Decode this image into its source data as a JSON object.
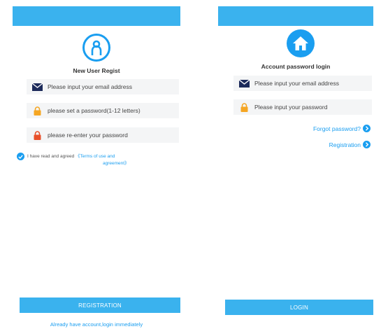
{
  "register": {
    "title": "New User Regist",
    "email_placeholder": "Please input your email address",
    "password_placeholder": "please set a password(1-12 letters)",
    "reenter_placeholder": "please re-enter your password",
    "agree_text": "I have read and agreed",
    "terms_link_line1": "《Terms of use and",
    "terms_link_line2": "agreement》",
    "button_label": "REGISTRATION",
    "login_link": "Already have account,login immediately"
  },
  "login": {
    "title": "Account password login",
    "email_placeholder": "Please input your email address",
    "password_placeholder": "Please input your password",
    "forgot_link": "Forgot password?",
    "registration_link": "Registration",
    "button_label": "LOGIN"
  },
  "colors": {
    "accent": "#3ab2ee",
    "link": "#1a9ef0",
    "field_bg": "#f4f5f6",
    "envelope": "#1c2a5a",
    "lock_orange": "#f5a623",
    "lock_red": "#e8502a"
  },
  "icons": [
    "person-icon",
    "home-icon",
    "envelope-icon",
    "lock-icon",
    "check-icon",
    "chevron-right-icon"
  ]
}
